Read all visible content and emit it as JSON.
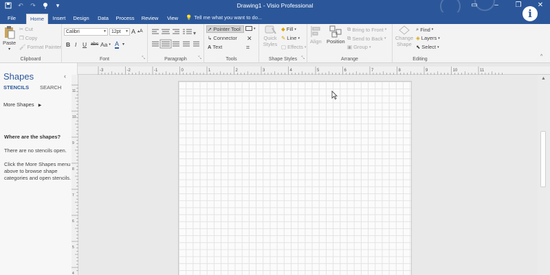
{
  "window": {
    "title": "Drawing1 - Visio Professional"
  },
  "tabs": [
    "File",
    "Home",
    "Insert",
    "Design",
    "Data",
    "Process",
    "Review",
    "View"
  ],
  "tell_me": "Tell me what you want to do...",
  "ribbon": {
    "clipboard": {
      "paste": "Paste",
      "cut": "Cut",
      "copy": "Copy",
      "format_painter": "Format Painter",
      "label": "Clipboard"
    },
    "font": {
      "font_name": "Calibri",
      "font_size": "12pt",
      "bold": "B",
      "italic": "I",
      "underline": "U",
      "strike": "abc",
      "case": "Aa",
      "color": "A",
      "grow": "A",
      "shrink": "A",
      "label": "Font"
    },
    "paragraph": {
      "label": "Paragraph"
    },
    "tools": {
      "pointer": "Pointer Tool",
      "connector": "Connector",
      "text": "Text",
      "label": "Tools"
    },
    "shape_styles": {
      "quick_styles": "Quick Styles",
      "fill": "Fill",
      "line": "Line",
      "effects": "Effects",
      "label": "Shape Styles"
    },
    "arrange": {
      "align": "Align",
      "position": "Position",
      "bring_front": "Bring to Front",
      "send_back": "Send to Back",
      "group": "Group",
      "label": "Arrange"
    },
    "editing": {
      "change_shape": "Change Shape",
      "find": "Find",
      "layers": "Layers",
      "select": "Select",
      "label": "Editing"
    }
  },
  "shapes_pane": {
    "title": "Shapes",
    "tab_stencils": "STENCILS",
    "tab_search": "SEARCH",
    "more_shapes": "More Shapes",
    "heading": "Where are the shapes?",
    "no_stencils": "There are no stencils open.",
    "help": "Click the More Shapes menu above to browse shape categories and open stencils."
  },
  "ruler": {
    "h_labels": [
      "-3",
      "-2",
      "-1",
      "0",
      "1",
      "2",
      "3",
      "4",
      "5",
      "6",
      "7",
      "8",
      "9",
      "10",
      "11"
    ],
    "v_labels": [
      "11",
      "10",
      "9",
      "8",
      "7",
      "6",
      "5",
      "4"
    ]
  },
  "colors": {
    "accent": "#2b579a",
    "ribbon_bg": "#f3f3f3",
    "canvas_bg": "#e9e9e9"
  }
}
